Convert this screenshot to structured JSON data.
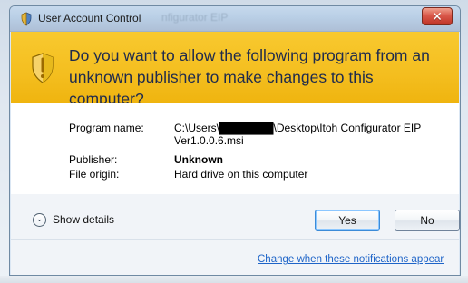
{
  "window": {
    "title": "User Account Control",
    "background_title_fragment": "nfigurator EIP",
    "close_icon": "close-icon"
  },
  "banner": {
    "icon": "shield-warning-icon",
    "message": "Do you want to allow the following program from an unknown publisher to make changes to this computer?"
  },
  "details": {
    "program_name_label": "Program name:",
    "program_name_value": "C:\\Users\\███████\\Desktop\\Itoh Configurator EIP Ver1.0.0.6.msi",
    "publisher_label": "Publisher:",
    "publisher_value": "Unknown",
    "file_origin_label": "File origin:",
    "file_origin_value": "Hard drive on this computer"
  },
  "footer": {
    "show_details_label": "Show details",
    "show_details_icon": "chevron-down-icon",
    "yes_label": "Yes",
    "no_label": "No",
    "notifications_link": "Change when these notifications appear"
  },
  "colors": {
    "banner": "#F4BE1F",
    "link": "#1E64C8",
    "title_bar": "#B9CFE6"
  }
}
